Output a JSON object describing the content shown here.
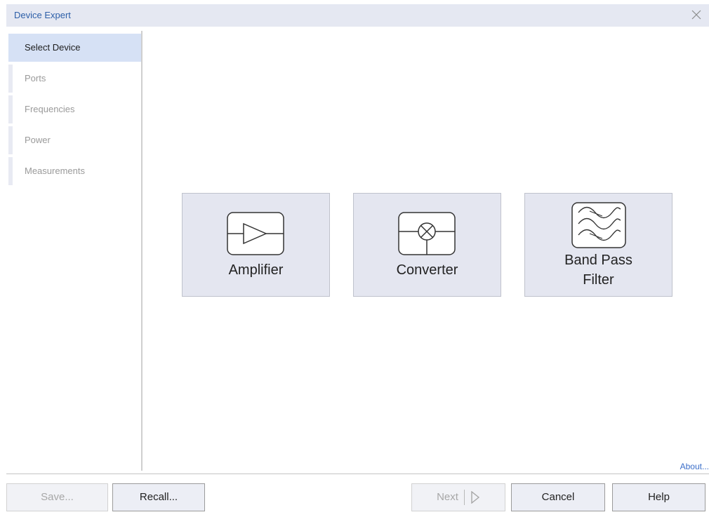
{
  "window": {
    "title": "Device Expert",
    "close_icon": "close-icon"
  },
  "sidebar": {
    "items": [
      {
        "label": "Select Device",
        "active": true
      },
      {
        "label": "Ports",
        "active": false
      },
      {
        "label": "Frequencies",
        "active": false
      },
      {
        "label": "Power",
        "active": false
      },
      {
        "label": "Measurements",
        "active": false
      }
    ]
  },
  "devices": [
    {
      "label": "Amplifier",
      "icon": "amplifier-icon"
    },
    {
      "label": "Converter",
      "icon": "mixer-icon"
    },
    {
      "label": "Band Pass",
      "label2": "Filter",
      "icon": "band-pass-filter-icon"
    }
  ],
  "about": {
    "label": "About..."
  },
  "footer": {
    "save_label": "Save...",
    "recall_label": "Recall...",
    "next_label": "Next",
    "cancel_label": "Cancel",
    "help_label": "Help"
  },
  "colors": {
    "title_text": "#2d5fa8",
    "titlebar_bg": "#e5e8f2",
    "active_item_bg": "#d6e1f5",
    "card_bg": "#e4e6f0",
    "link": "#3b6ec9"
  }
}
